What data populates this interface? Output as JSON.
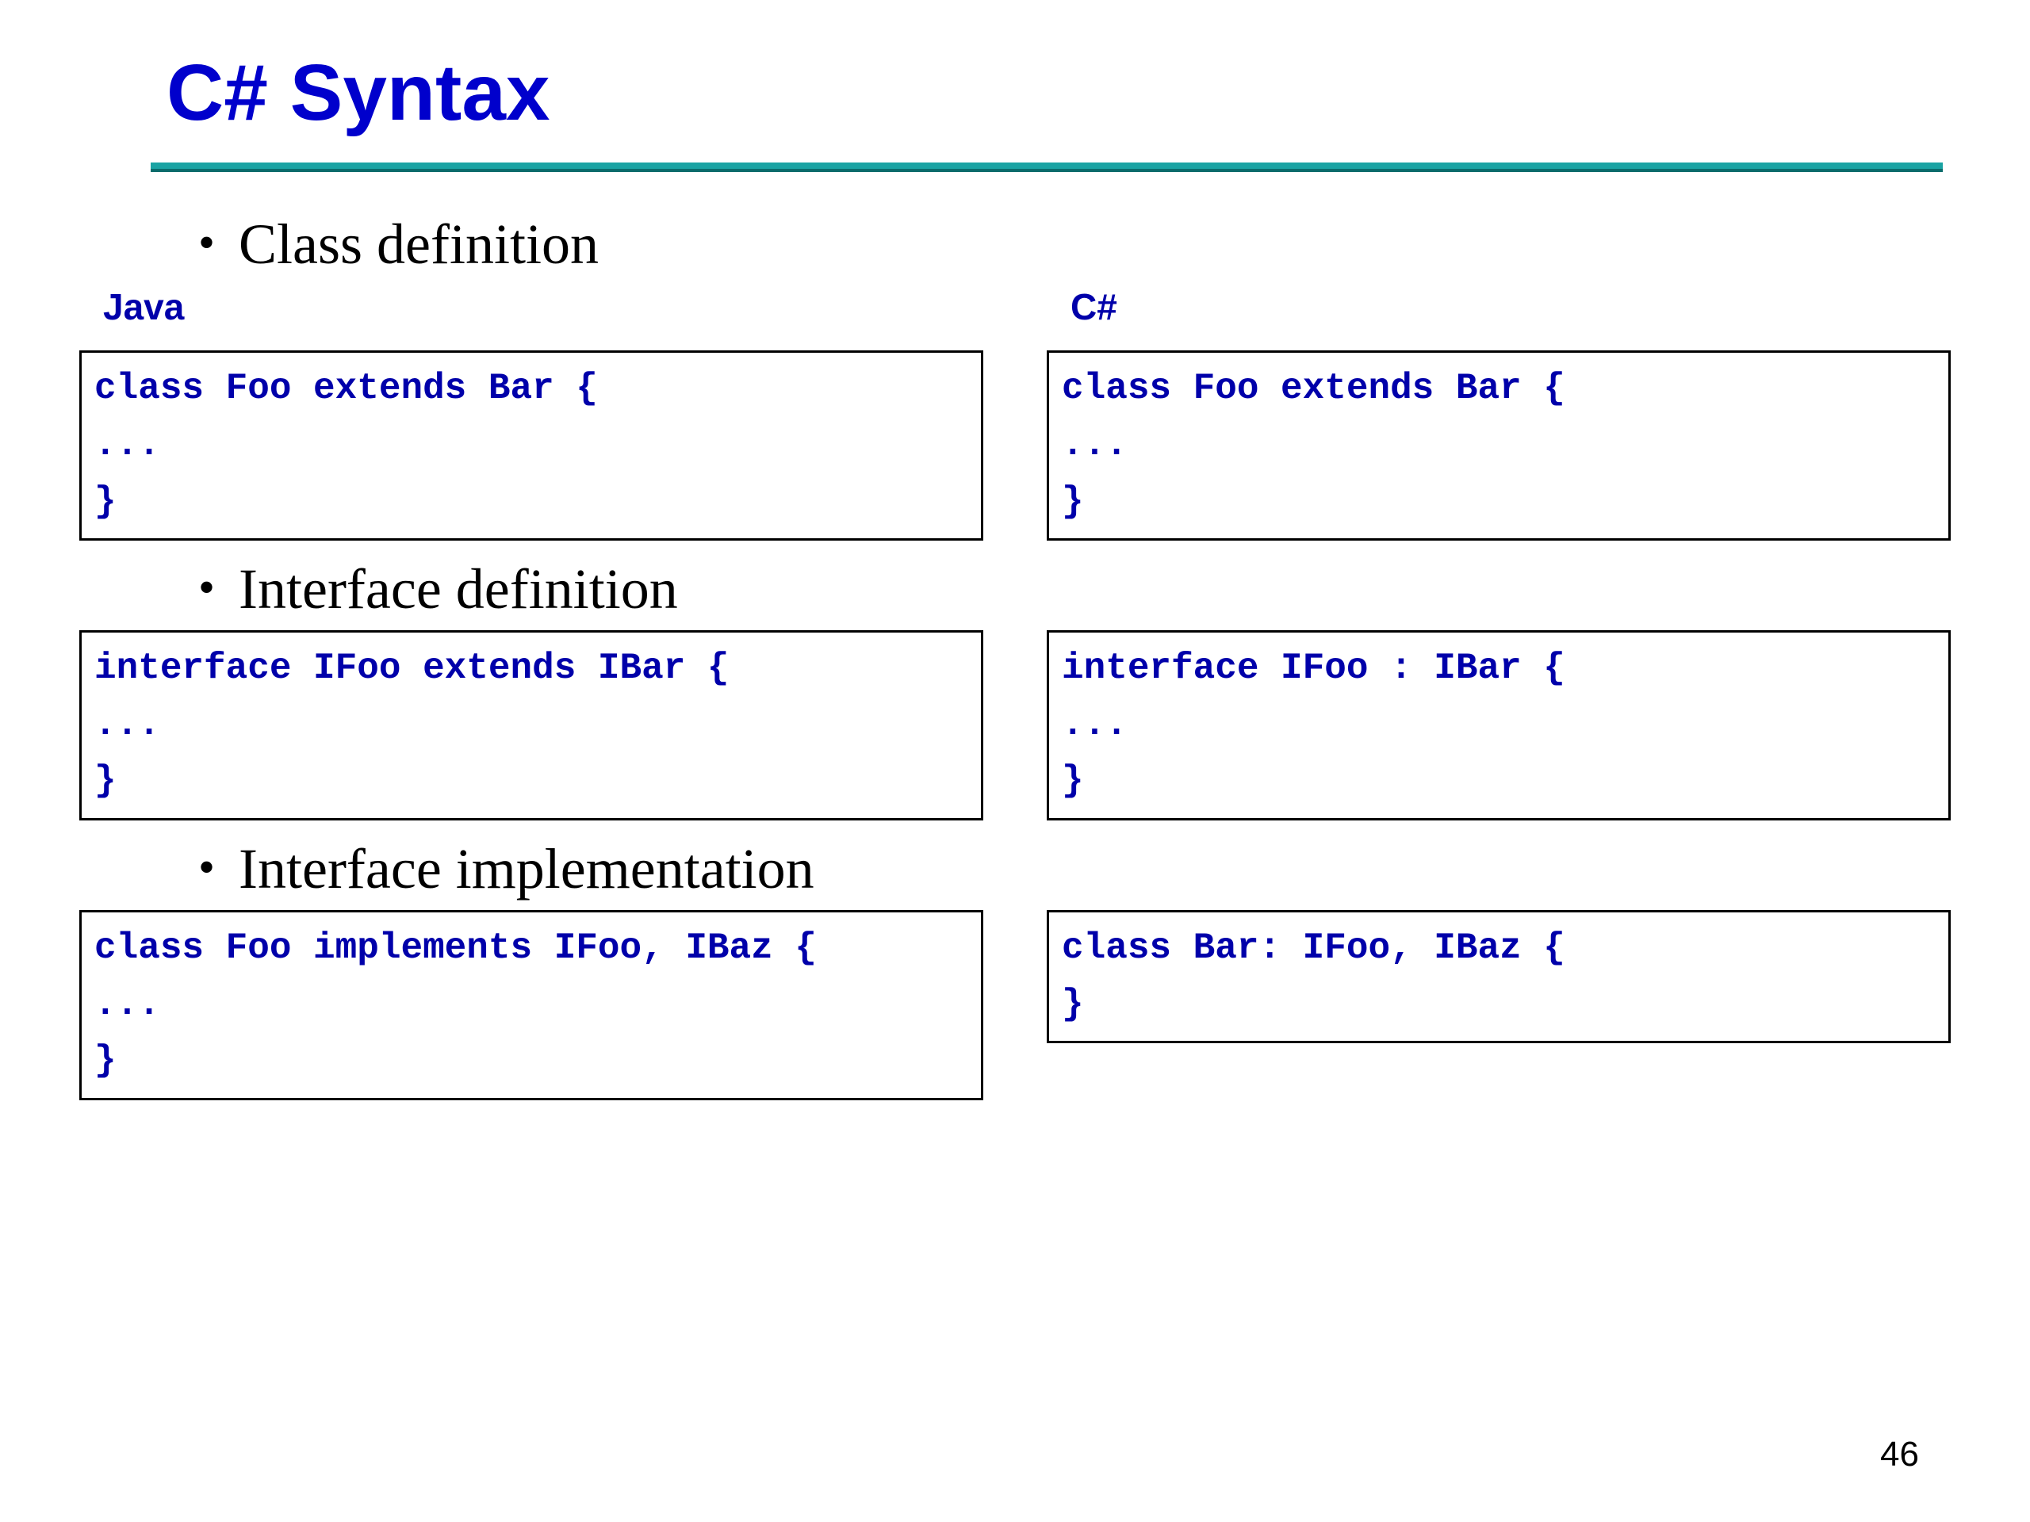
{
  "title": "C# Syntax",
  "bullets": {
    "class_def": "Class definition",
    "interface_def": "Interface definition",
    "interface_impl": "Interface implementation"
  },
  "labels": {
    "java": "Java",
    "csharp": "C#"
  },
  "code": {
    "class_java": "class Foo extends Bar {\n...\n}",
    "class_cs": "class Foo extends Bar {\n...\n}",
    "iface_java": "interface IFoo extends IBar {\n...\n}",
    "iface_cs": "interface IFoo : IBar {\n...\n}",
    "impl_java": "class Foo implements IFoo, IBaz {\n...\n}",
    "impl_cs": "class Bar: IFoo, IBaz {\n}"
  },
  "page_number": "46"
}
